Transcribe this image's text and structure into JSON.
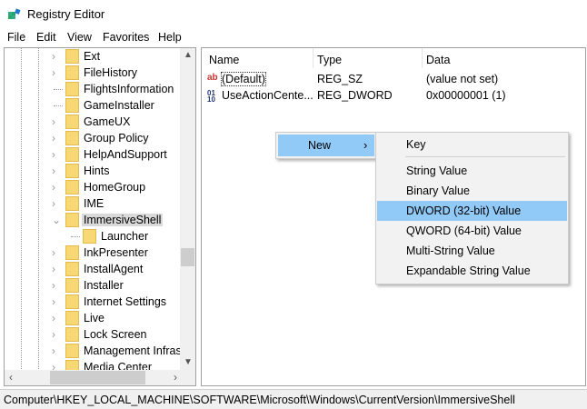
{
  "window": {
    "title": "Registry Editor",
    "icon": "registry-icon"
  },
  "menu": [
    "File",
    "Edit",
    "View",
    "Favorites",
    "Help"
  ],
  "tree": [
    {
      "label": "Ext",
      "expander": true
    },
    {
      "label": "FileHistory",
      "expander": true
    },
    {
      "label": "FlightsInformation",
      "expander": false
    },
    {
      "label": "GameInstaller",
      "expander": false
    },
    {
      "label": "GameUX",
      "expander": true
    },
    {
      "label": "Group Policy",
      "expander": true
    },
    {
      "label": "HelpAndSupport",
      "expander": true
    },
    {
      "label": "Hints",
      "expander": true
    },
    {
      "label": "HomeGroup",
      "expander": true
    },
    {
      "label": "IME",
      "expander": true
    },
    {
      "label": "ImmersiveShell",
      "expander": true,
      "expanded": true,
      "selected": true
    },
    {
      "label": "Launcher",
      "expander": false,
      "child": true
    },
    {
      "label": "InkPresenter",
      "expander": true
    },
    {
      "label": "InstallAgent",
      "expander": true
    },
    {
      "label": "Installer",
      "expander": true
    },
    {
      "label": "Internet Settings",
      "expander": true
    },
    {
      "label": "Live",
      "expander": true
    },
    {
      "label": "Lock Screen",
      "expander": true
    },
    {
      "label": "Management Infrast",
      "expander": true
    },
    {
      "label": "Media Center",
      "expander": true
    }
  ],
  "list": {
    "headers": {
      "name": "Name",
      "type": "Type",
      "data": "Data"
    },
    "rows": [
      {
        "name": "(Default)",
        "type": "REG_SZ",
        "data": "(value not set)",
        "icon": "string-value-icon"
      },
      {
        "name": "UseActionCente...",
        "type": "REG_DWORD",
        "data": "0x00000001 (1)",
        "icon": "binary-value-icon"
      }
    ]
  },
  "context_menu": {
    "new_label": "New",
    "arrow": "›"
  },
  "submenu": [
    "Key",
    "String Value",
    "Binary Value",
    "DWORD (32-bit) Value",
    "QWORD (64-bit) Value",
    "Multi-String Value",
    "Expandable String Value"
  ],
  "submenu_highlighted": "DWORD (32-bit) Value",
  "status": "Computer\\HKEY_LOCAL_MACHINE\\SOFTWARE\\Microsoft\\Windows\\CurrentVersion\\ImmersiveShell"
}
